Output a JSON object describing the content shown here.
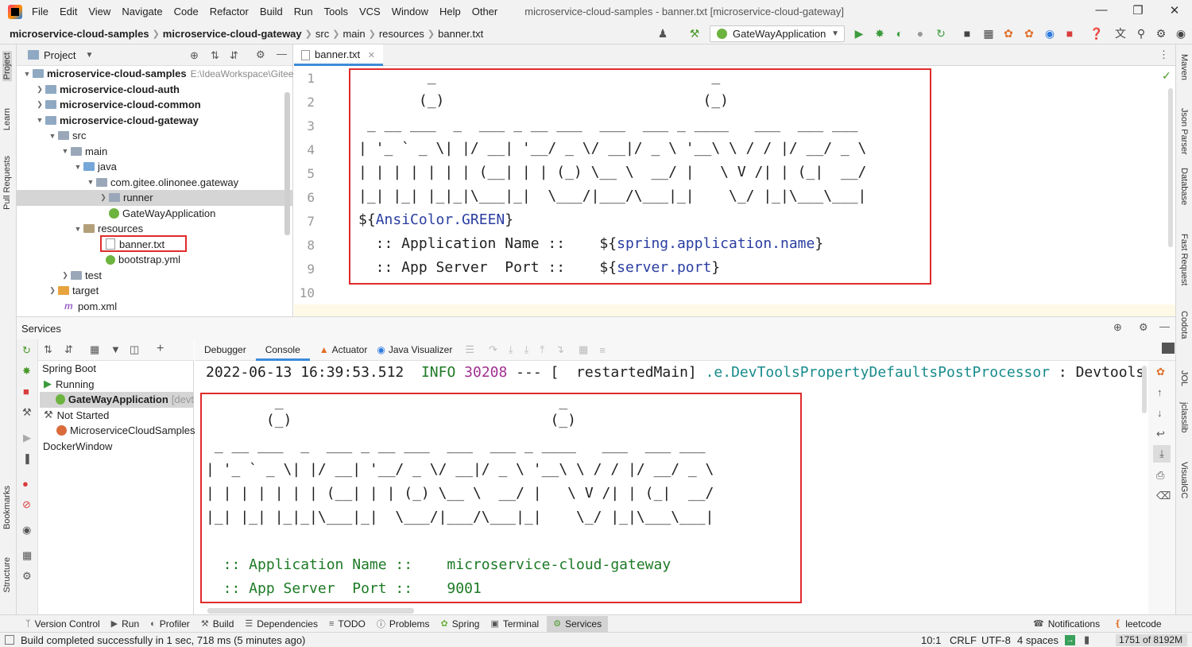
{
  "titlebar": {
    "menus": [
      "File",
      "Edit",
      "View",
      "Navigate",
      "Code",
      "Refactor",
      "Build",
      "Run",
      "Tools",
      "VCS",
      "Window",
      "Help",
      "Other"
    ],
    "title": "microservice-cloud-samples - banner.txt [microservice-cloud-gateway]"
  },
  "navbar": {
    "crumbs": [
      "microservice-cloud-samples",
      "microservice-cloud-gateway",
      "src",
      "main",
      "resources",
      "banner.txt"
    ],
    "run_config": "GateWayApplication"
  },
  "left_strip": {
    "labels": [
      "Project",
      "Learn",
      "Pull Requests",
      "Bookmarks",
      "Structure"
    ]
  },
  "right_strip": {
    "labels": [
      "Maven",
      "Json Parser",
      "Database",
      "Fast Request",
      "Codota",
      "JOL",
      "jclasslib",
      "VisualGC"
    ]
  },
  "project_panel": {
    "title": "Project",
    "tree": [
      {
        "label": "microservice-cloud-samples",
        "path": "E:\\IdeaWorkspace\\Gitee"
      },
      {
        "label": "microservice-cloud-auth"
      },
      {
        "label": "microservice-cloud-common"
      },
      {
        "label": "microservice-cloud-gateway"
      },
      {
        "label": "src"
      },
      {
        "label": "main"
      },
      {
        "label": "java"
      },
      {
        "label": "com.gitee.olinonee.gateway"
      },
      {
        "label": "runner"
      },
      {
        "label": "GateWayApplication"
      },
      {
        "label": "resources"
      },
      {
        "label": "banner.txt"
      },
      {
        "label": "bootstrap.yml"
      },
      {
        "label": "test"
      },
      {
        "label": "target"
      },
      {
        "label": "pom.xml"
      }
    ]
  },
  "editor": {
    "tab": "banner.txt",
    "line_numbers": [
      "1",
      "2",
      "3",
      "4",
      "5",
      "6",
      "7",
      "8",
      "9",
      "10"
    ],
    "lines": [
      "        _                                _",
      "       (_)                              (_)",
      " _ __ ___  _  ___ _ __ ___  ___  ___ _ ____   ___  ___ ___",
      "| '_ ` _ \\| |/ __| '__/ _ \\/ __|/ _ \\ '__\\ \\ / / |/ __/ _ \\",
      "| | | | | | | (__| | | (_) \\__ \\  __/ |   \\ V /| | (_|  __/",
      "|_| |_| |_|_|\\___|_|  \\___/|___/\\___|_|    \\_/ |_|\\___\\___|"
    ],
    "line7_prefix": "${",
    "line7_var": "AnsiColor.GREEN",
    "line7_suffix": "}",
    "line8_prefix": "  :: Application Name ::    ${",
    "line8_var": "spring.application.name",
    "line8_suffix": "}",
    "line9_prefix": "  :: App Server  Port ::    ${",
    "line9_var": "server.port",
    "line9_suffix": "}"
  },
  "services": {
    "title": "Services",
    "tree": {
      "spring_boot": "Spring Boot",
      "running": "Running",
      "app": "GateWayApplication",
      "app_suffix": "[devt",
      "not_started": "Not Started",
      "samples": "MicroserviceCloudSamples",
      "docker": "DockerWindow"
    },
    "tabs": [
      "Debugger",
      "Console",
      "Actuator",
      "Java Visualizer"
    ],
    "log": {
      "timestamp": "2022-06-13 16:39:53.512",
      "level": "INFO",
      "pid": "30208",
      "rest": " --- [  restartedMain] ",
      "logger": ".e.DevToolsPropertyDefaultsPostProcessor",
      "msg": " : Devtools"
    },
    "banner_lines": [
      "        _                                _",
      "       (_)                              (_)",
      " _ __ ___  _  ___ _ __ ___  ___  ___ _ ____   ___  ___ ___",
      "| '_ ` _ \\| |/ __| '__/ _ \\/ __|/ _ \\ '__\\ \\ / / |/ __/ _ \\",
      "| | | | | | | (__| | | (_) \\__ \\  __/ |   \\ V /| | (_|  __/",
      "|_| |_| |_|_|\\___|_|  \\___/|___/\\___|_|    \\_/ |_|\\___\\___|"
    ],
    "app_name_line": "  :: Application Name ::    microservice-cloud-gateway",
    "port_line": "  :: App Server  Port ::    9001"
  },
  "bottom_tools": [
    "Version Control",
    "Run",
    "Profiler",
    "Build",
    "Dependencies",
    "TODO",
    "Problems",
    "Spring",
    "Terminal",
    "Services"
  ],
  "bottom_right": [
    "Notifications",
    "leetcode"
  ],
  "status": {
    "message": "Build completed successfully in 1 sec, 718 ms (5 minutes ago)",
    "position": "10:1",
    "line_sep": "CRLF",
    "encoding": "UTF-8",
    "indent": "4 spaces",
    "memory": "1751 of 8192M"
  },
  "colors": {
    "accent": "#3d8bd8",
    "highlight_box": "#e02b2b",
    "console_green": "#1d7a25",
    "placeholder_blue": "#2a3ea1"
  }
}
